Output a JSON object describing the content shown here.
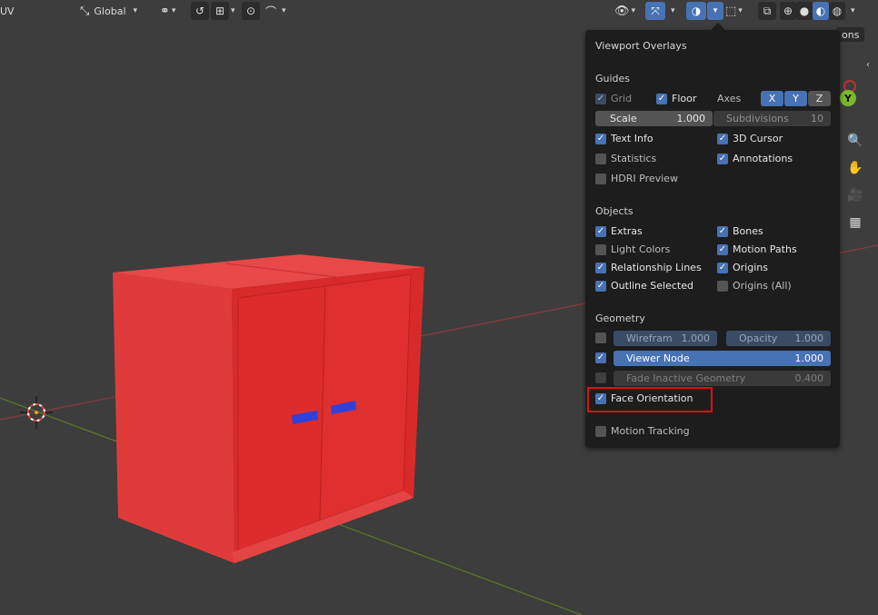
{
  "header": {
    "mode_label": "UV",
    "transform_orientation": "Global"
  },
  "overlays_panel": {
    "title": "Viewport Overlays",
    "guides": {
      "heading": "Guides",
      "grid": "Grid",
      "floor": "Floor",
      "axes_label": "Axes",
      "axis_x": "X",
      "axis_y": "Y",
      "axis_z": "Z",
      "scale_label": "Scale",
      "scale_value": "1.000",
      "subdivisions_label": "Subdivisions",
      "subdivisions_value": "10",
      "text_info": "Text Info",
      "cursor_3d": "3D Cursor",
      "statistics": "Statistics",
      "annotations": "Annotations",
      "hdri_preview": "HDRI Preview"
    },
    "objects": {
      "heading": "Objects",
      "extras": "Extras",
      "bones": "Bones",
      "light_colors": "Light Colors",
      "motion_paths": "Motion Paths",
      "relationship_lines": "Relationship Lines",
      "origins": "Origins",
      "outline_selected": "Outline Selected",
      "origins_all": "Origins (All)"
    },
    "geometry": {
      "heading": "Geometry",
      "wireframe_label": "Wirefram",
      "wireframe_value": "1.000",
      "opacity_label": "Opacity",
      "opacity_value": "1.000",
      "viewer_node_label": "Viewer Node",
      "viewer_node_value": "1.000",
      "fade_label": "Fade Inactive Geometry",
      "fade_value": "0.400",
      "face_orientation": "Face Orientation",
      "motion_tracking": "Motion Tracking"
    }
  },
  "partial_text": "ons",
  "gizmo": {
    "axis_y": "Y"
  }
}
